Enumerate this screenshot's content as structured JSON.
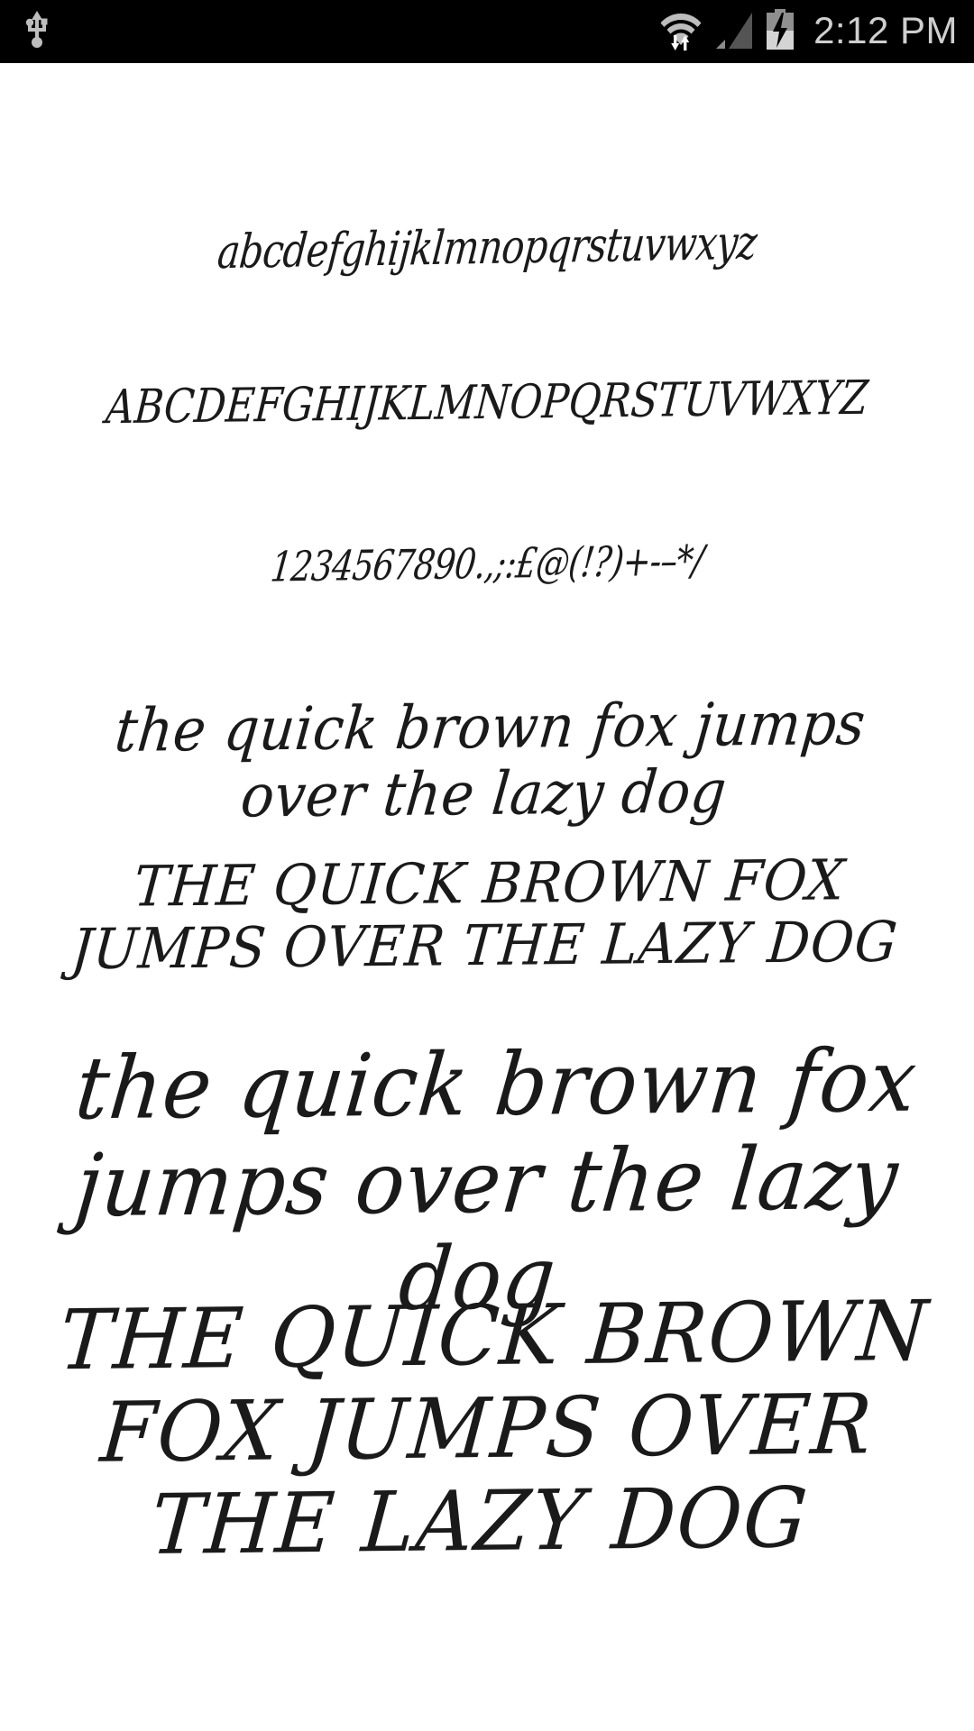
{
  "status_bar": {
    "background_color": "#000000",
    "icon_color": "#bdbdbd",
    "clock": "2:12 PM",
    "left_icons": [
      {
        "name": "usb-icon",
        "label": "USB connected"
      }
    ],
    "right_icons": [
      {
        "name": "wifi-icon",
        "label": "Wi-Fi with data transfer"
      },
      {
        "name": "cellular-signal-icon",
        "label": "Cellular signal"
      },
      {
        "name": "battery-charging-icon",
        "label": "Battery charging"
      }
    ]
  },
  "preview": {
    "background_color": "#ffffff",
    "text_color": "#1a1a1a",
    "lines": [
      {
        "id": "lowercase-alphabet",
        "text": "abcdefghijklmnopqrstuvwxyz"
      },
      {
        "id": "uppercase-alphabet",
        "text": "ABCDEFGHIJKLMNOPQRSTUVWXYZ"
      },
      {
        "id": "numbers-symbols",
        "text": "1234567890.,;:£@(!?)+-–*/"
      },
      {
        "id": "pangram-lower-small",
        "text": "the quick brown fox jumps over the lazy dog"
      },
      {
        "id": "pangram-upper-small",
        "text": "THE QUICK BROWN FOX JUMPS OVER THE LAZY DOG"
      },
      {
        "id": "pangram-lower-large",
        "text": "the quick brown fox jumps over the lazy dog"
      },
      {
        "id": "pangram-upper-large",
        "text": "THE QUICK BROWN FOX JUMPS OVER THE LAZY DOG"
      }
    ]
  }
}
